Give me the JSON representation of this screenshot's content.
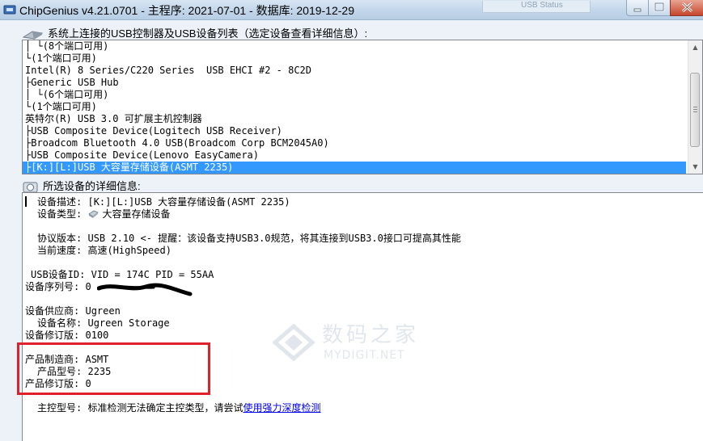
{
  "window": {
    "title": "ChipGenius v4.21.0701 - 主程序: 2021-07-01 - 数据库: 2019-12-29",
    "background_window_text": "USB Status"
  },
  "device_list": {
    "header": "系统上连接的USB控制器及USB设备列表（选定设备查看详细信息）:",
    "rows": [
      {
        "branch": "│ └",
        "text": "(8个端口可用)",
        "selected": false
      },
      {
        "branch": "└",
        "text": "(1个端口可用)",
        "selected": false
      },
      {
        "branch": "",
        "text": "Intel(R) 8 Series/C220 Series  USB EHCI #2 - 8C2D",
        "selected": false
      },
      {
        "branch": "├",
        "text": "Generic USB Hub",
        "selected": false
      },
      {
        "branch": "│ └",
        "text": "(6个端口可用)",
        "selected": false
      },
      {
        "branch": "└",
        "text": "(1个端口可用)",
        "selected": false
      },
      {
        "branch": "",
        "text": "英特尔(R) USB 3.0 可扩展主机控制器",
        "selected": false
      },
      {
        "branch": "├",
        "text": "USB Composite Device(Logitech USB Receiver)",
        "selected": false
      },
      {
        "branch": "├",
        "text": "Broadcom Bluetooth 4.0 USB(Broadcom Corp BCM2045A0)",
        "selected": false
      },
      {
        "branch": "├",
        "text": "USB Composite Device(Lenovo EasyCamera)",
        "selected": false
      },
      {
        "branch": "├",
        "text": "[K:][L:]USB 大容量存储设备(ASMT 2235)",
        "selected": true
      }
    ]
  },
  "details": {
    "header": "所选设备的详细信息:",
    "fields": {
      "device_desc": {
        "label": "设备描述:",
        "value": "[K:][L:]USB 大容量存储设备(ASMT 2235)"
      },
      "device_type": {
        "label": "设备类型:",
        "value": "大容量存储设备"
      },
      "protocol": {
        "label": "协议版本:",
        "value": "USB 2.10 <- 提醒：该设备支持USB3.0规范，将其连接到USB3.0接口可提高其性能"
      },
      "speed": {
        "label": "当前速度:",
        "value": "高速(HighSpeed)"
      },
      "usb_id": {
        "label": "USB设备ID:",
        "value": "VID = 174C PID = 55AA"
      },
      "serial": {
        "label": "设备序列号:",
        "value": "0"
      },
      "vendor": {
        "label": "设备供应商:",
        "value": "Ugreen"
      },
      "device_name": {
        "label": "设备名称:",
        "value": "Ugreen Storage"
      },
      "device_rev": {
        "label": "设备修订版:",
        "value": "0100"
      },
      "manufacturer": {
        "label": "产品制造商:",
        "value": "ASMT"
      },
      "product_model": {
        "label": "产品型号:",
        "value": "2235"
      },
      "product_rev": {
        "label": "产品修订版:",
        "value": "0"
      },
      "controller": {
        "label": "主控型号:",
        "value": "标准检测无法确定主控类型，请尝试",
        "link": "使用强力深度检测"
      }
    }
  },
  "watermark": {
    "main": "数码之家",
    "sub": "MYDIGIT.NET"
  },
  "colors": {
    "selection": "#3399ff",
    "highlight_box": "#e0202a",
    "link": "#0000ee"
  }
}
